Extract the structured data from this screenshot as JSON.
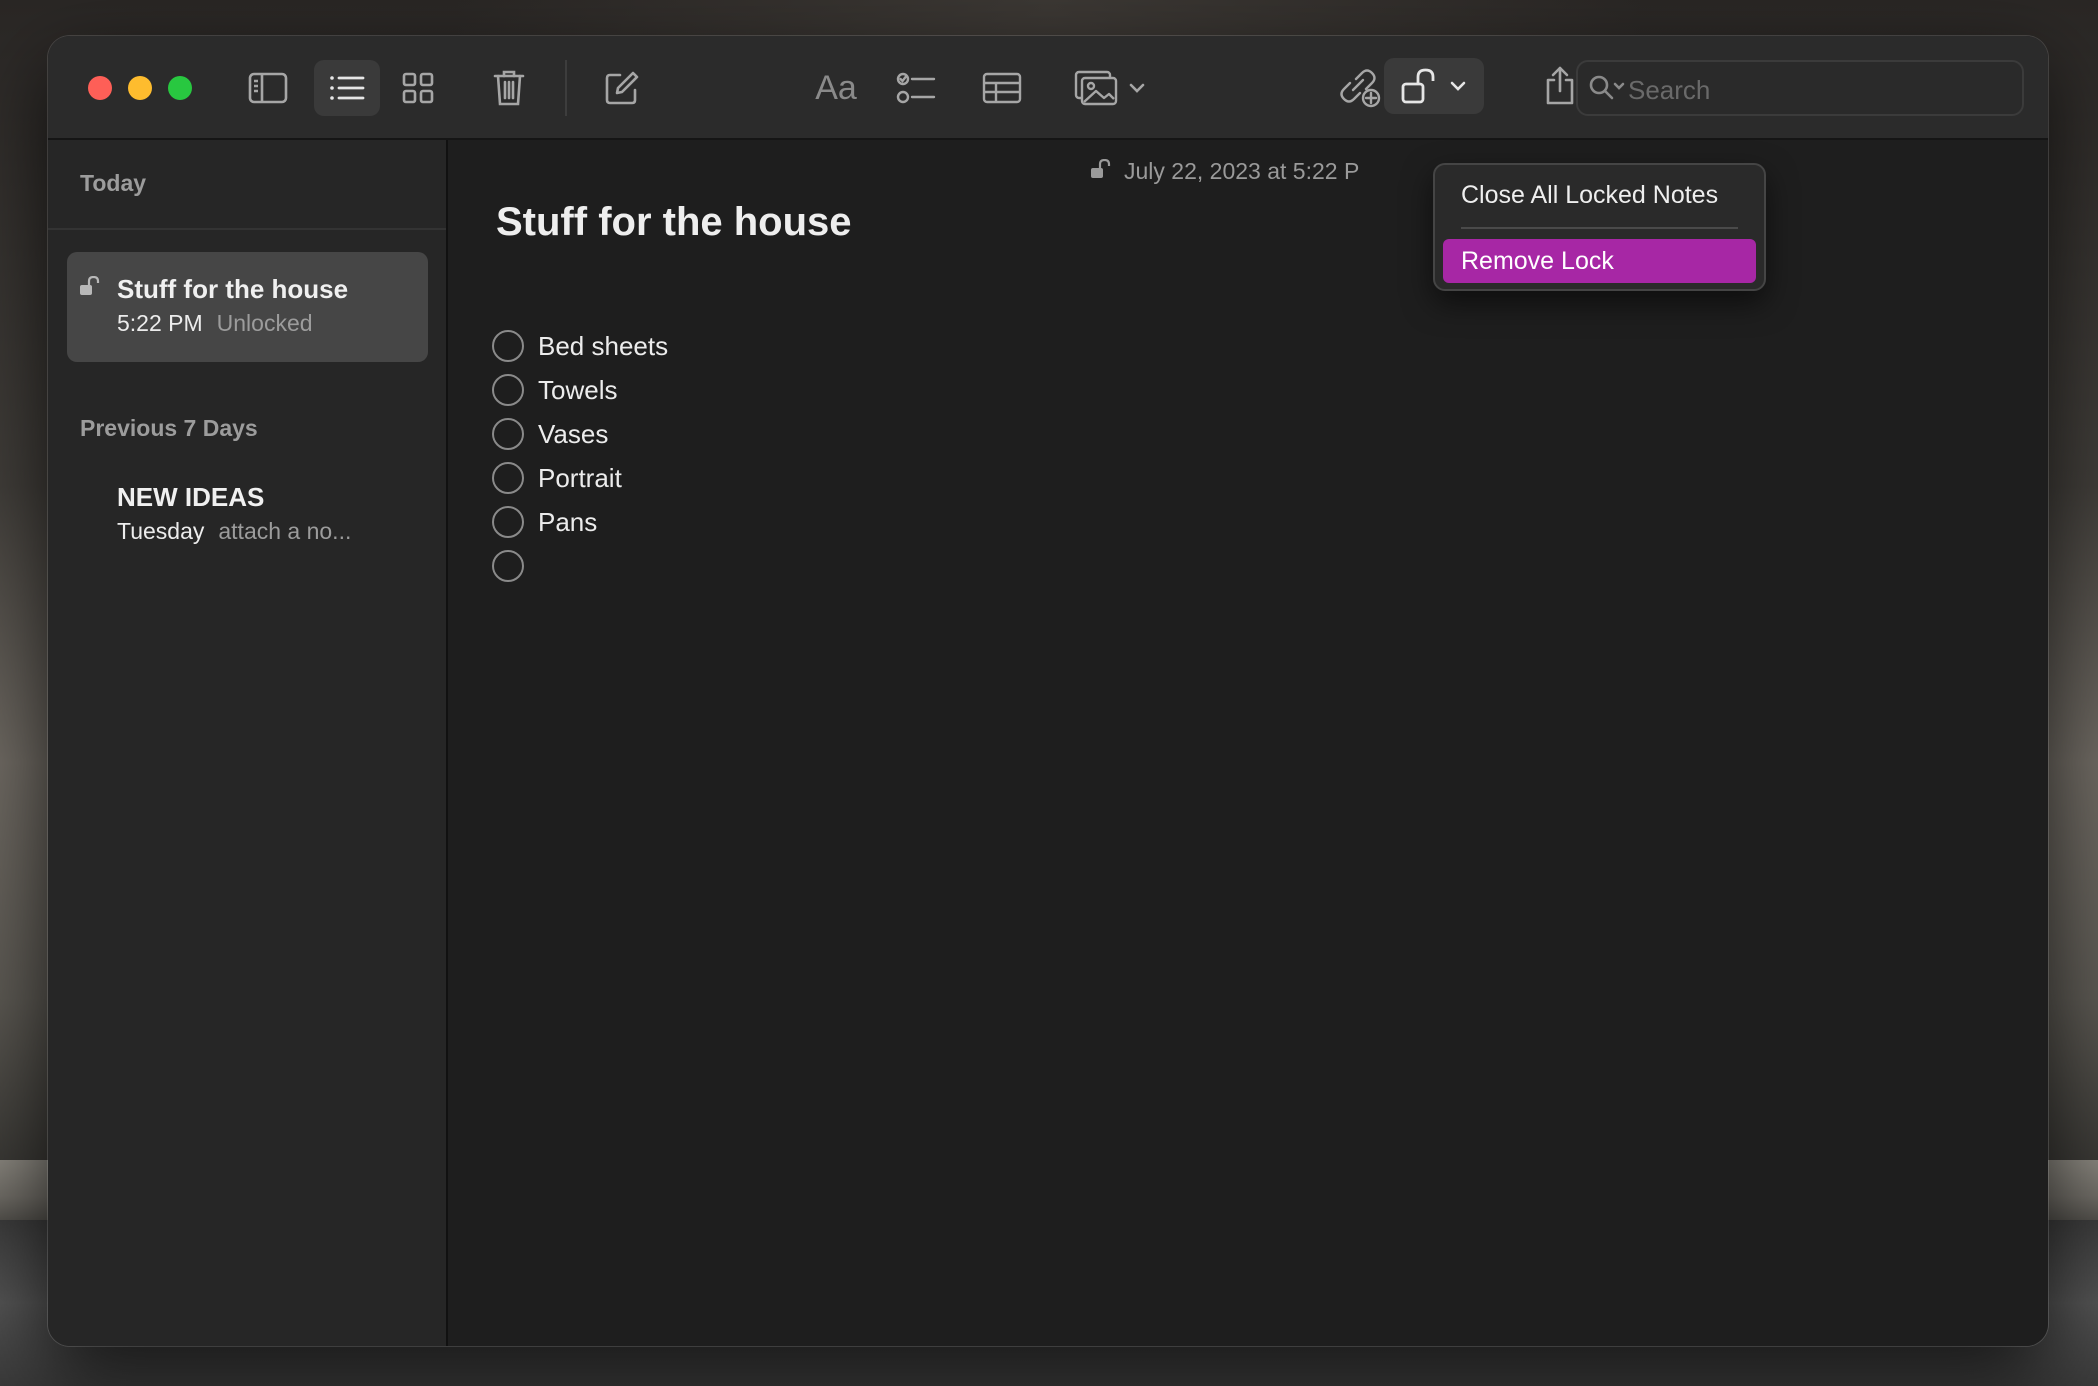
{
  "toolbar": {
    "buttons": [
      {
        "icon": "sidebar-toggle-icon"
      },
      {
        "icon": "list-view-icon",
        "active": true
      },
      {
        "icon": "gallery-view-icon"
      },
      {
        "icon": "trash-icon"
      },
      {
        "icon": "compose-icon"
      },
      {
        "icon": "format-text-icon",
        "label": "Aa"
      },
      {
        "icon": "checklist-icon"
      },
      {
        "icon": "table-icon"
      },
      {
        "icon": "media-icon"
      },
      {
        "icon": "collaborate-icon"
      },
      {
        "icon": "lock-icon",
        "active": true
      },
      {
        "icon": "share-icon"
      }
    ],
    "search": {
      "placeholder": "Search"
    }
  },
  "sidebar": {
    "sections": [
      {
        "header": "Today",
        "notes": [
          {
            "title": "Stuff for the house",
            "time": "5:22 PM",
            "preview": "Unlocked",
            "locked": true,
            "selected": true
          }
        ]
      },
      {
        "header": "Previous 7 Days",
        "notes": [
          {
            "title": "NEW IDEAS",
            "time": "Tuesday",
            "preview": "attach a no..."
          }
        ]
      }
    ]
  },
  "editor": {
    "date_text": "July 22, 2023 at 5:22 P",
    "title": "Stuff for the house",
    "checklist": [
      {
        "text": "Bed sheets"
      },
      {
        "text": "Towels"
      },
      {
        "text": "Vases"
      },
      {
        "text": "Portrait"
      },
      {
        "text": "Pans"
      },
      {
        "text": ""
      }
    ]
  },
  "lock_menu": {
    "items": [
      {
        "label": "Close All Locked Notes"
      },
      {
        "label": "Remove Lock",
        "highlighted": true
      }
    ]
  },
  "colors": {
    "accent": "#a727a5",
    "close": "#fe5f57",
    "minimize": "#febc2e",
    "maximize": "#28c840"
  }
}
